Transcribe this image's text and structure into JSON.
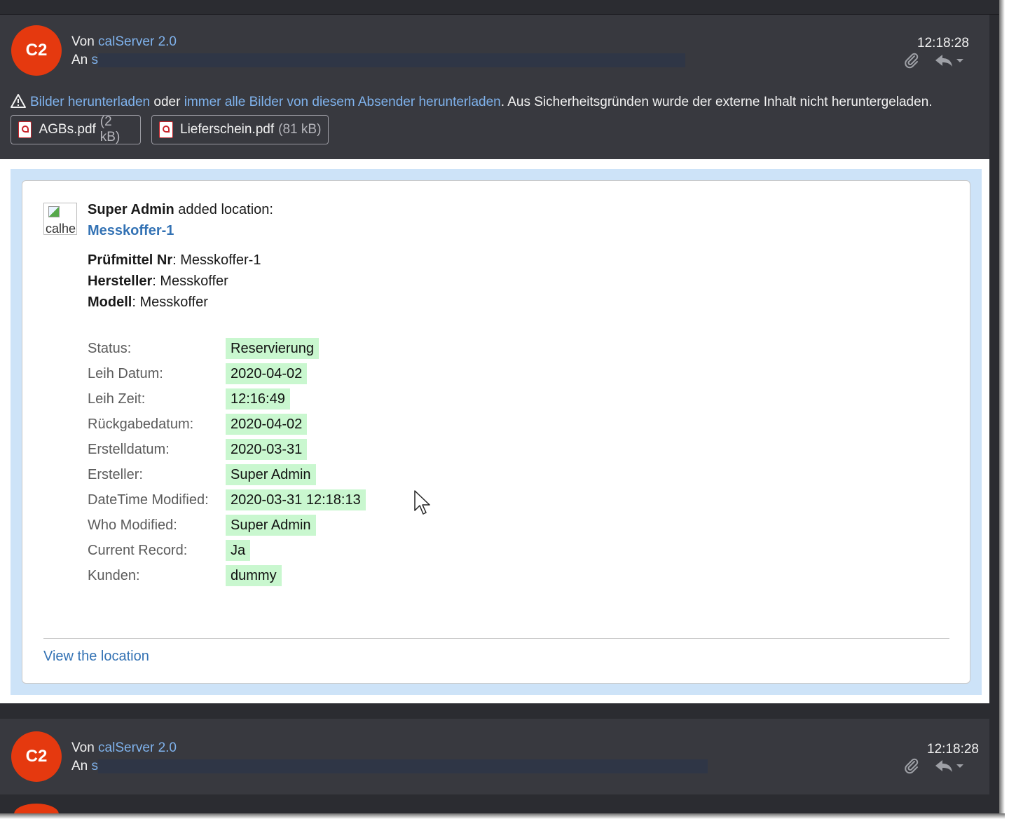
{
  "message1": {
    "avatar_initials": "C2",
    "from_label": "Von",
    "from_name": "calServer 2.0",
    "to_label": "An",
    "to_partial": "s",
    "time": "12:18:28"
  },
  "warning": {
    "link1": "Bilder herunterladen",
    "or_text": " oder ",
    "link2": "immer alle Bilder von diesem Absender herunterladen",
    "rest": ". Aus Sicherheitsgründen wurde der externe Inhalt nicht heruntergeladen."
  },
  "attachments": [
    {
      "name": "AGBs.pdf",
      "size": "(2 kB)"
    },
    {
      "name": "Lieferschein.pdf",
      "size": "(81 kB)"
    }
  ],
  "card": {
    "broken_image_alt": "calhe",
    "actor": "Super Admin",
    "action_text": " added location:",
    "location_name": "Messkoffer-1",
    "fields": [
      {
        "label": "Prüfmittel Nr",
        "value": ": Messkoffer-1"
      },
      {
        "label": "Hersteller",
        "value": ": Messkoffer"
      },
      {
        "label": "Modell",
        "value": ": Messkoffer"
      }
    ],
    "rows": [
      {
        "label": "Status:",
        "value": "Reservierung"
      },
      {
        "label": "Leih Datum:",
        "value": "2020-04-02"
      },
      {
        "label": "Leih Zeit:",
        "value": "12:16:49"
      },
      {
        "label": "Rückgabedatum:",
        "value": "2020-04-02"
      },
      {
        "label": "Erstelldatum:",
        "value": "2020-03-31"
      },
      {
        "label": "Ersteller:",
        "value": "Super Admin"
      },
      {
        "label": "DateTime Modified:",
        "value": "2020-03-31 12:18:13"
      },
      {
        "label": "Who Modified:",
        "value": "Super Admin"
      },
      {
        "label": "Current Record:",
        "value": "Ja"
      },
      {
        "label": "Kunden:",
        "value": "dummy"
      }
    ],
    "view_link": "View the location"
  },
  "message2": {
    "avatar_initials": "C2",
    "from_label": "Von",
    "from_name": "calServer 2.0",
    "to_label": "An",
    "to_partial": "s",
    "time": "12:18:28"
  },
  "colors": {
    "avatar": "#e5390f",
    "link": "#7fb2ec",
    "card_link": "#3372b4",
    "value_highlight": "#c9f7cf",
    "band": "#cde3f8"
  }
}
